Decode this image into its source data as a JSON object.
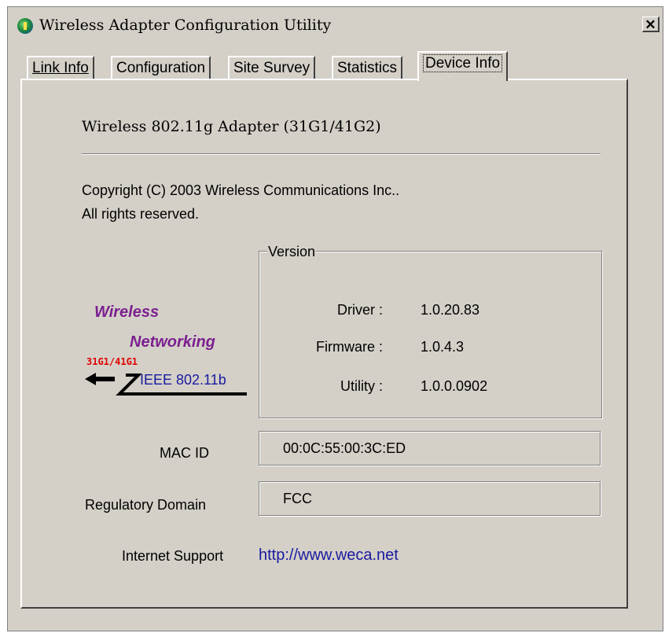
{
  "window": {
    "title": "Wireless Adapter Configuration Utility",
    "close_label": "✕"
  },
  "tabs": [
    {
      "label": "Link Info"
    },
    {
      "label": "Configuration"
    },
    {
      "label": "Site Survey"
    },
    {
      "label": "Statistics"
    },
    {
      "label": "Device Info"
    }
  ],
  "active_tab": "Device Info",
  "device": {
    "product_name": "Wireless 802.11g Adapter (31G1/41G2)",
    "copyright": "Copyright (C) 2003 Wireless Communications Inc..",
    "rights": "All rights reserved."
  },
  "logo": {
    "line1": "Wireless",
    "line2": "Networking",
    "model": "31G1/41G1",
    "standard": "IEEE 802.11b"
  },
  "version": {
    "legend": "Version",
    "rows": [
      {
        "label": "Driver :",
        "value": "1.0.20.83"
      },
      {
        "label": "Firmware :",
        "value": "1.0.4.3"
      },
      {
        "label": "Utility :",
        "value": "1.0.0.0902"
      }
    ]
  },
  "mac": {
    "label": "MAC ID",
    "value": "00:0C:55:00:3C:ED"
  },
  "regulatory": {
    "label": "Regulatory Domain",
    "value": "FCC"
  },
  "support": {
    "label": "Internet Support",
    "link": "http://www.weca.net"
  }
}
